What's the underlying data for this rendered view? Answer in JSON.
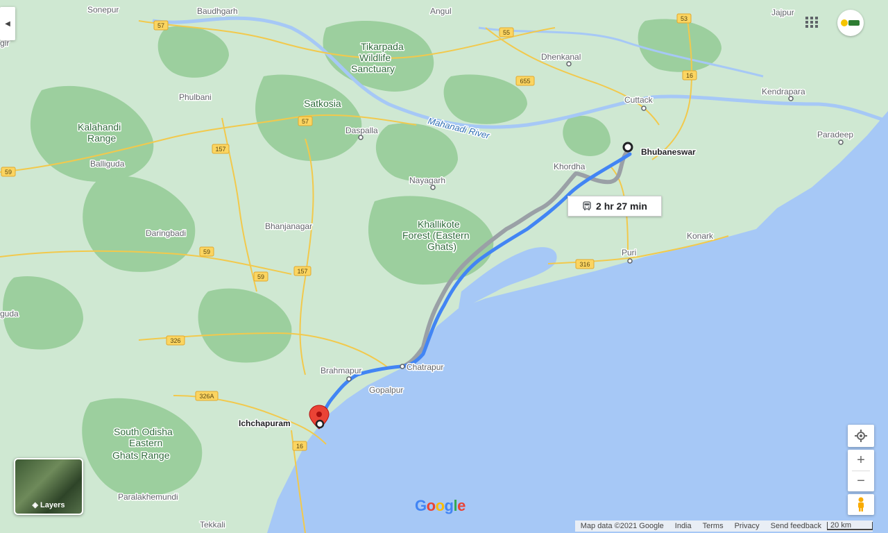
{
  "map": {
    "regions": [
      "Tikarpada Wildlife Sanctuary",
      "Satkosia",
      "Kalahandi Range",
      "Khallikote Forest (Eastern Ghats)",
      "South Odisha Eastern Ghats Range"
    ],
    "places": {
      "sonepur": "Sonepur",
      "baudhgarh": "Baudhgarh",
      "angul": "Angul",
      "dhenkanal": "Dhenkanal",
      "jajpur": "Jajpur",
      "kendrapara": "Kendrapara",
      "cuttack": "Cuttack",
      "paradeep": "Paradeep",
      "bhubaneswar": "Bhubaneswar",
      "khordha": "Khordha",
      "phulbani": "Phulbani",
      "daspalla": "Daspalla",
      "balliguda": "Balliguda",
      "nayagarh": "Nayagarh",
      "daringbadi": "Daringbadi",
      "bhanjanagar": "Bhanjanagar",
      "puri": "Puri",
      "konark": "Konark",
      "brahmapur": "Brahmapur",
      "chatrapur": "Chatrapur",
      "gopalpur": "Gopalpur",
      "ichchapuram": "Ichchapuram",
      "paralakhemundi": "Paralakhemundi",
      "tekkali": "Tekkali",
      "gir_edge": "gir",
      "guda_edge": "guda"
    },
    "river": "Mahanadi River",
    "tikarpada": [
      "Tikarpada",
      "Wildlife",
      "Sanctuary"
    ],
    "satkosia": "Satkosia",
    "kalahandi": [
      "Kalahandi",
      "Range"
    ],
    "khallikote": [
      "Khallikote",
      "Forest (Eastern",
      "Ghats)"
    ],
    "south_odisha": [
      "South Odisha",
      "Eastern",
      "Ghats Range"
    ],
    "highways": [
      "57",
      "57",
      "55",
      "53",
      "655",
      "16",
      "157",
      "59",
      "59",
      "157",
      "59",
      "326",
      "326A",
      "316",
      "16"
    ]
  },
  "route": {
    "duration": "2 hr 27 min",
    "mode_icon": "bus-icon",
    "origin": "Bhubaneswar",
    "destination": "Ichchapuram",
    "color": "#4285f4",
    "alt_color": "#9aa0a6"
  },
  "controls": {
    "layers_label": "Layers",
    "collapse_arrow": "◀",
    "zoom_in": "+",
    "zoom_out": "−"
  },
  "footer": {
    "map_data": "Map data ©2021 Google",
    "country": "India",
    "terms": "Terms",
    "privacy": "Privacy",
    "feedback": "Send feedback",
    "scale": "20 km"
  },
  "logo": "Google",
  "colors": {
    "land": "#cfe8d2",
    "forest": "#9ccf9e",
    "water": "#a6c8f6",
    "road": "#fbd561"
  }
}
